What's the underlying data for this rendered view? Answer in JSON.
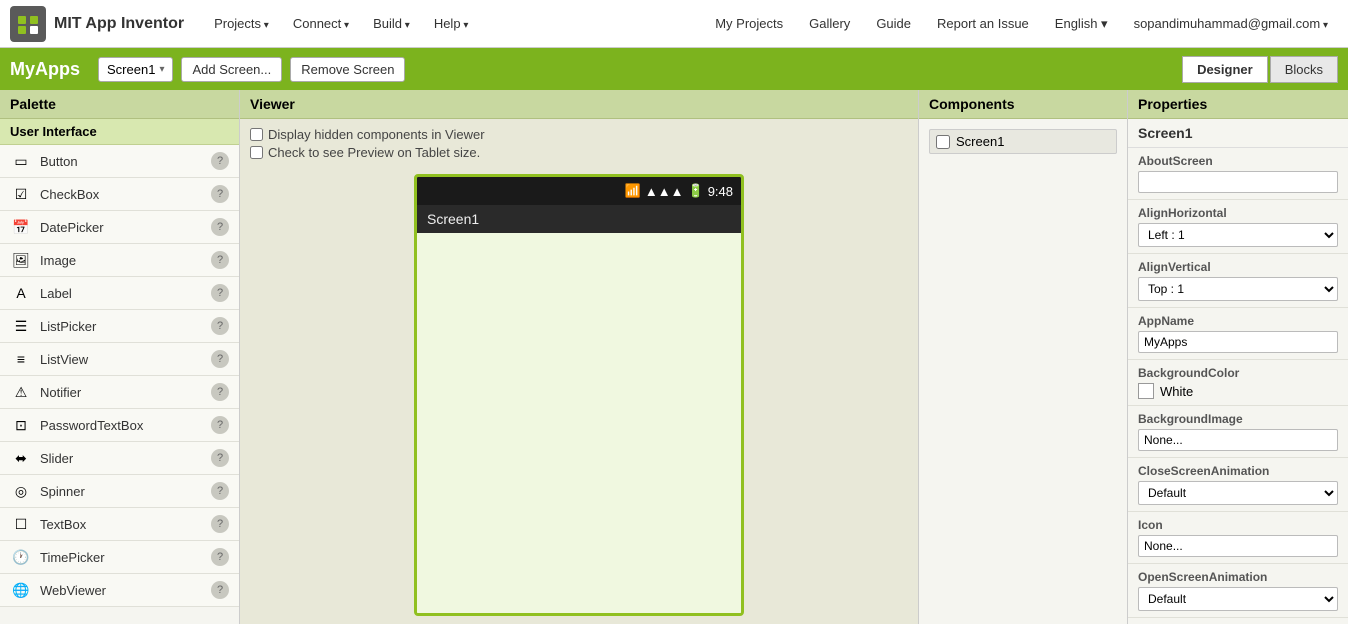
{
  "app": {
    "logo_text": "MIT App Inventor",
    "project_name": "MyApps"
  },
  "nav": {
    "items": [
      {
        "label": "Projects",
        "has_arrow": true
      },
      {
        "label": "Connect",
        "has_arrow": true
      },
      {
        "label": "Build",
        "has_arrow": true
      },
      {
        "label": "Help",
        "has_arrow": true
      }
    ],
    "right_items": [
      {
        "label": "My Projects"
      },
      {
        "label": "Gallery"
      },
      {
        "label": "Guide"
      },
      {
        "label": "Report an Issue"
      },
      {
        "label": "English",
        "has_arrow": true
      }
    ],
    "user_email": "sopandimuhammad@gmail.com"
  },
  "toolbar": {
    "screen_name": "Screen1",
    "add_screen": "Add Screen...",
    "remove_screen": "Remove Screen",
    "designer_btn": "Designer",
    "blocks_btn": "Blocks"
  },
  "palette": {
    "header": "Palette",
    "section": "User Interface",
    "items": [
      {
        "label": "Button",
        "icon": "btn"
      },
      {
        "label": "CheckBox",
        "icon": "chk"
      },
      {
        "label": "DatePicker",
        "icon": "dat"
      },
      {
        "label": "Image",
        "icon": "img"
      },
      {
        "label": "Label",
        "icon": "lbl"
      },
      {
        "label": "ListPicker",
        "icon": "lst"
      },
      {
        "label": "ListView",
        "icon": "lsv"
      },
      {
        "label": "Notifier",
        "icon": "ntf"
      },
      {
        "label": "PasswordTextBox",
        "icon": "pwd"
      },
      {
        "label": "Slider",
        "icon": "sld"
      },
      {
        "label": "Spinner",
        "icon": "spn"
      },
      {
        "label": "TextBox",
        "icon": "txt"
      },
      {
        "label": "TimePicker",
        "icon": "tim"
      },
      {
        "label": "WebViewer",
        "icon": "web"
      }
    ]
  },
  "viewer": {
    "header": "Viewer",
    "checkbox1": "Display hidden components in Viewer",
    "checkbox2": "Check to see Preview on Tablet size.",
    "phone_time": "9:48",
    "screen_title": "Screen1"
  },
  "components": {
    "header": "Components",
    "items": [
      {
        "label": "Screen1"
      }
    ]
  },
  "properties": {
    "header": "Properties",
    "screen_name": "Screen1",
    "fields": [
      {
        "key": "AboutScreen",
        "label": "AboutScreen",
        "type": "input",
        "value": ""
      },
      {
        "key": "AlignHorizontal",
        "label": "AlignHorizontal",
        "type": "select",
        "value": "Left : 1"
      },
      {
        "key": "AlignVertical",
        "label": "AlignVertical",
        "type": "select",
        "value": "Top : 1"
      },
      {
        "key": "AppName",
        "label": "AppName",
        "type": "input",
        "value": "MyApps"
      },
      {
        "key": "BackgroundColor",
        "label": "BackgroundColor",
        "type": "color",
        "color": "#ffffff",
        "color_label": "White"
      },
      {
        "key": "BackgroundImage",
        "label": "BackgroundImage",
        "type": "input",
        "value": "None..."
      },
      {
        "key": "CloseScreenAnimation",
        "label": "CloseScreenAnimation",
        "type": "select",
        "value": "Default"
      },
      {
        "key": "Icon",
        "label": "Icon",
        "type": "input",
        "value": "None..."
      },
      {
        "key": "OpenScreenAnimation",
        "label": "OpenScreenAnimation",
        "type": "select",
        "value": "Default"
      }
    ]
  },
  "icons": {
    "btn": "▭",
    "chk": "☑",
    "dat": "📅",
    "img": "🖼",
    "lbl": "A",
    "lst": "☰",
    "lsv": "≡",
    "ntf": "⚠",
    "pwd": "⊡",
    "sld": "⬌",
    "spn": "◎",
    "txt": "☐",
    "tim": "🕐",
    "web": "🌐"
  }
}
